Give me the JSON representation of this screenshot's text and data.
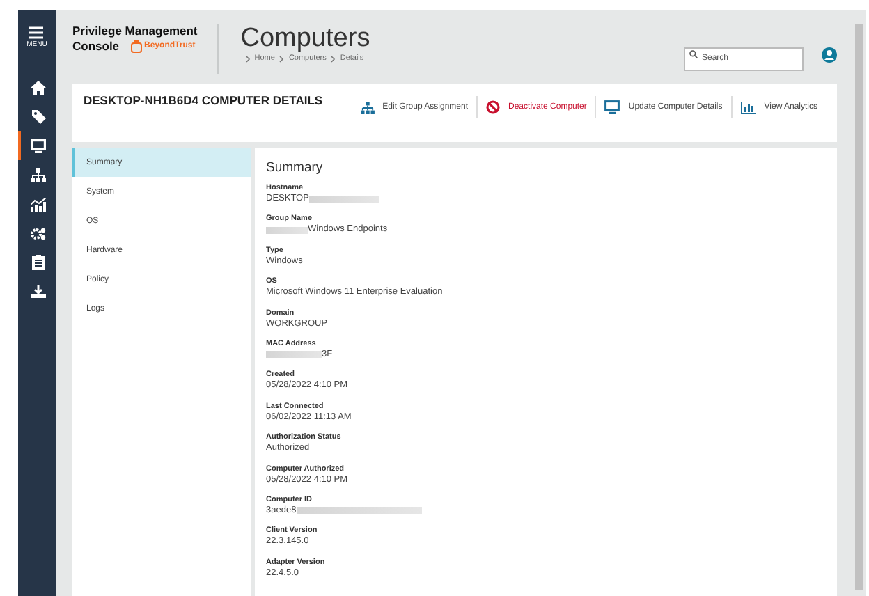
{
  "sidebar": {
    "menu_label": "MENU",
    "items": [
      {
        "kind": "home",
        "selected": false
      },
      {
        "kind": "tag",
        "selected": false
      },
      {
        "kind": "monitor",
        "selected": true
      },
      {
        "kind": "sitemap",
        "selected": false
      },
      {
        "kind": "chart",
        "selected": false
      },
      {
        "kind": "gears",
        "selected": false
      },
      {
        "kind": "clipboard",
        "selected": false
      },
      {
        "kind": "download",
        "selected": false
      }
    ]
  },
  "header": {
    "product_line1": "Privilege Management",
    "product_line2": "Console",
    "vendor": "BeyondTrust",
    "title": "Computers",
    "breadcrumb": [
      "Home",
      "Computers",
      "Details"
    ],
    "search": {
      "placeholder": "Search"
    }
  },
  "details": {
    "title": "DESKTOP-NH1B6D4 COMPUTER DETAILS",
    "actions": [
      {
        "kind": "group",
        "label": "Edit Group Assignment"
      },
      {
        "kind": "deactivate",
        "label": "Deactivate Computer"
      },
      {
        "kind": "monitor",
        "label": "Update Computer Details"
      },
      {
        "kind": "analytics",
        "label": "View Analytics"
      }
    ]
  },
  "nav": [
    {
      "label": "Summary",
      "selected": true
    },
    {
      "label": "System",
      "selected": false
    },
    {
      "label": "OS",
      "selected": false
    },
    {
      "label": "Hardware",
      "selected": false
    },
    {
      "label": "Policy",
      "selected": false
    },
    {
      "label": "Logs",
      "selected": false
    }
  ],
  "summary": {
    "heading": "Summary",
    "fields": [
      {
        "label": "Hostname",
        "value": "DESKTOP",
        "masked_start": false,
        "masked_end": true
      },
      {
        "label": "Group Name",
        "value": "Windows Endpoints",
        "masked_start": true,
        "masked_end": false
      },
      {
        "label": "Type",
        "value": "Windows",
        "masked_start": false,
        "masked_end": false
      },
      {
        "label": "OS",
        "value": "Microsoft Windows 11 Enterprise Evaluation",
        "masked_start": false,
        "masked_end": false
      },
      {
        "label": "Domain",
        "value": "WORKGROUP",
        "masked_start": false,
        "masked_end": false
      },
      {
        "label": "MAC Address",
        "value": "3F",
        "masked_start": true,
        "masked_end": false
      },
      {
        "label": "Created",
        "value": "05/28/2022 4:10 PM",
        "masked_start": false,
        "masked_end": false
      },
      {
        "label": "Last Connected",
        "value": "06/02/2022 11:13 AM",
        "masked_start": false,
        "masked_end": false
      },
      {
        "label": "Authorization Status",
        "value": "Authorized",
        "masked_start": false,
        "masked_end": false
      },
      {
        "label": "Computer Authorized",
        "value": "05/28/2022 4:10 PM",
        "masked_start": false,
        "masked_end": false
      },
      {
        "label": "Computer ID",
        "value": "3aede8",
        "masked_start": false,
        "masked_end": true
      },
      {
        "label": "Client Version",
        "value": "22.3.145.0",
        "masked_start": false,
        "masked_end": false
      },
      {
        "label": "Adapter Version",
        "value": "22.4.5.0",
        "masked_start": false,
        "masked_end": false
      }
    ]
  }
}
